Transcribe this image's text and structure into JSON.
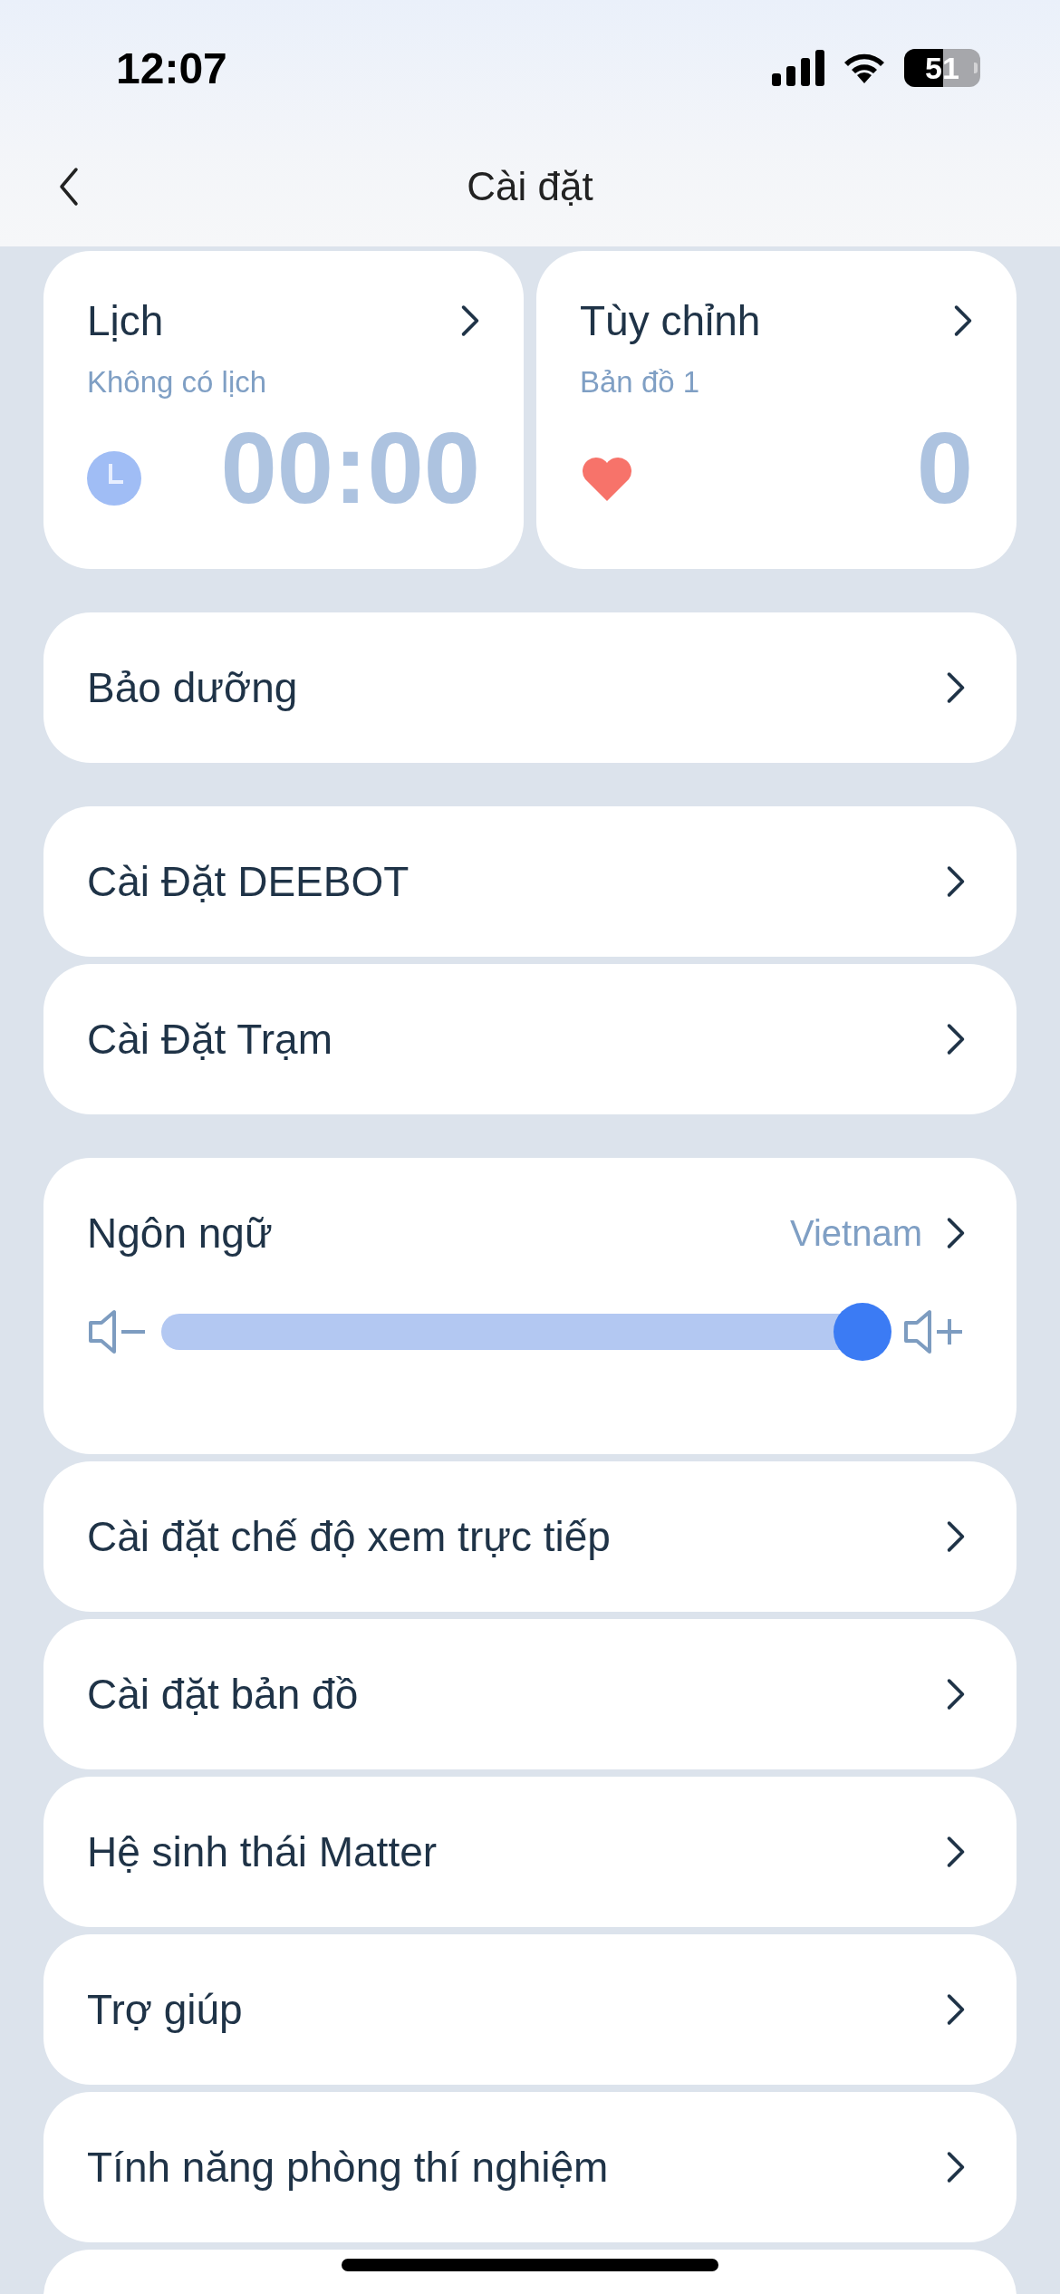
{
  "status_bar": {
    "time": "12:07",
    "battery": "51"
  },
  "nav": {
    "title": "Cài đặt"
  },
  "tiles": [
    {
      "kind": "clock",
      "title": "Lịch",
      "subtitle": "Không có lịch",
      "value": "00:00"
    },
    {
      "kind": "heart",
      "title": "Tùy chỉnh",
      "subtitle": "Bản đồ 1",
      "value": "0"
    }
  ],
  "groups": [
    [
      {
        "kind": "link",
        "label": "Bảo dưỡng"
      }
    ],
    [
      {
        "kind": "link",
        "label": "Cài Đặt DEEBOT"
      },
      {
        "kind": "link",
        "label": "Cài Đặt Trạm"
      }
    ],
    [
      {
        "kind": "volume",
        "label": "Ngôn ngữ",
        "value": "Vietnam",
        "level": 1
      },
      {
        "kind": "link",
        "label": "Cài đặt chế độ xem trực tiếp"
      },
      {
        "kind": "link",
        "label": "Cài đặt bản đồ"
      },
      {
        "kind": "link",
        "label": "Hệ sinh thái Matter"
      },
      {
        "kind": "link",
        "label": "Trợ giúp"
      },
      {
        "kind": "link",
        "label": "Tính năng phòng thí nghiệm"
      }
    ]
  ]
}
